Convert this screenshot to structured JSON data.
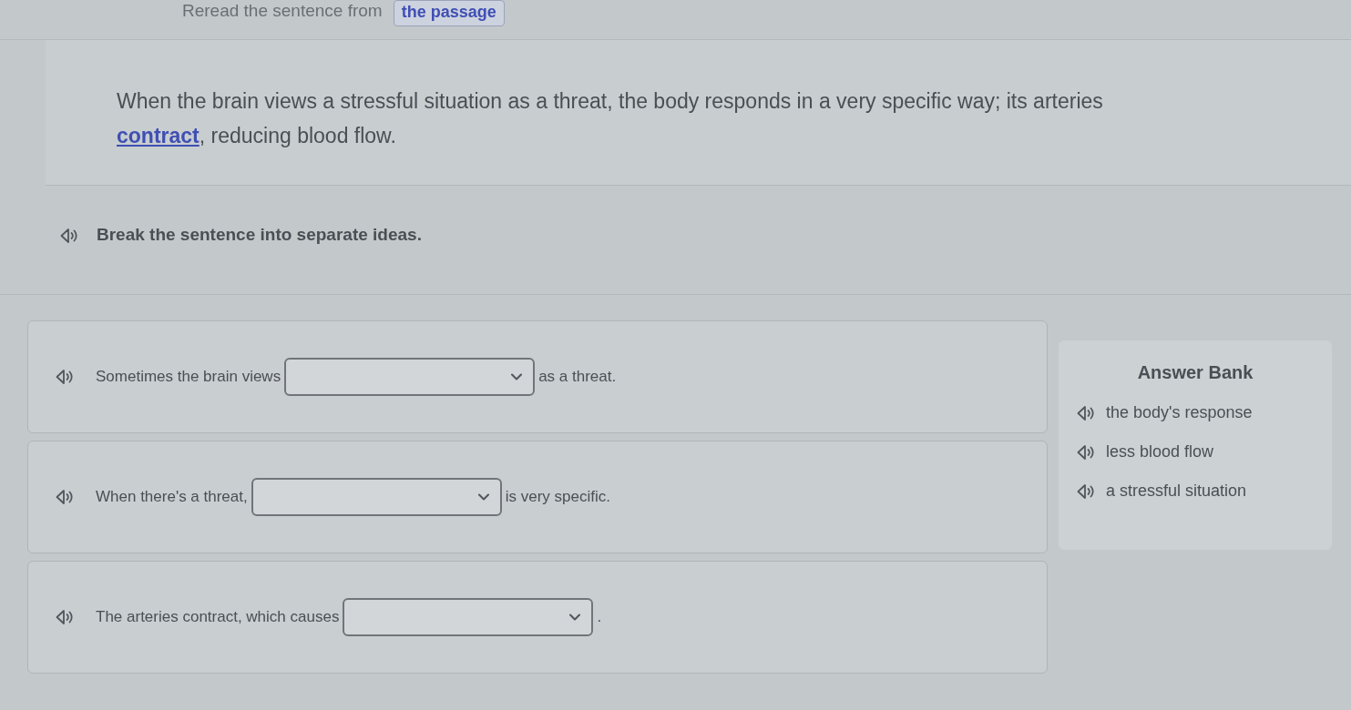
{
  "header": {
    "text": "Reread the sentence from",
    "link": "the passage"
  },
  "passage": {
    "before": "When the brain views a stressful situation as a threat, the body responds in a very specific way; its arteries ",
    "link": "contract",
    "after": ", reducing blood flow."
  },
  "instruction": "Break the sentence into separate ideas.",
  "questions": [
    {
      "before": "Sometimes the brain views",
      "after": "as a threat."
    },
    {
      "before": "When there's a threat,",
      "after": "is very specific."
    },
    {
      "before": "The arteries contract, which causes",
      "after": "."
    }
  ],
  "answer_bank": {
    "title": "Answer Bank",
    "items": [
      "the body's response",
      "less blood flow",
      "a stressful situation"
    ]
  }
}
